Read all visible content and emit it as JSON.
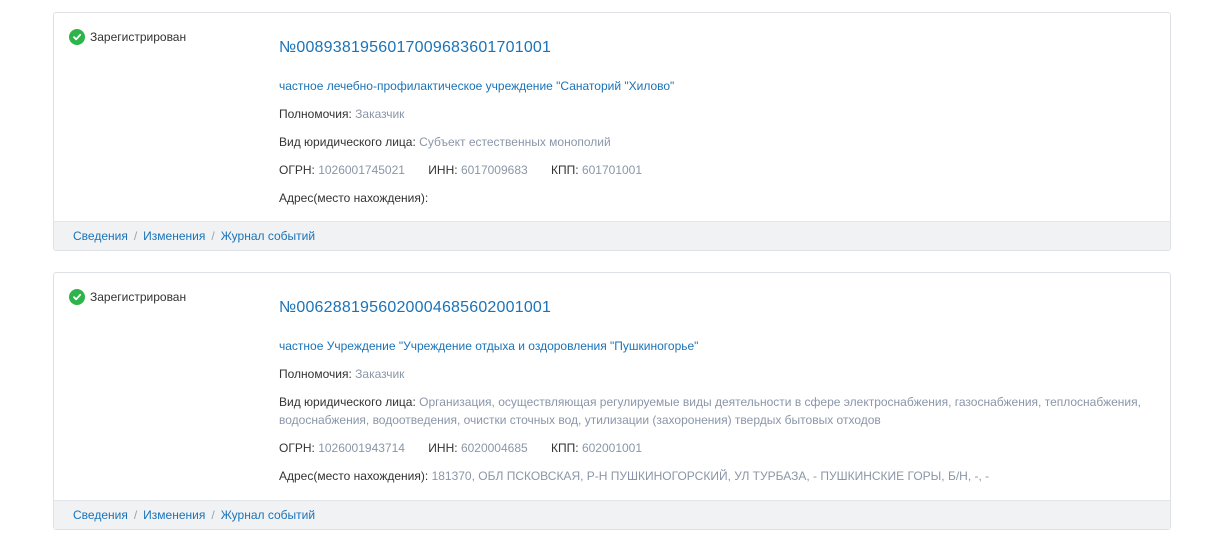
{
  "colors": {
    "link": "#1a73b8",
    "muted_value": "#8a96a8",
    "status_green": "#2db44a",
    "footer_bg": "#f0f2f4"
  },
  "entries": [
    {
      "status": "Зарегистрирован",
      "status_icon": "check-circle-icon",
      "number": "№00893819560170096836017010​01",
      "org_name": "частное лечебно-профилактическое учреждение \"Санаторий \"Хилово\"",
      "authority_label": "Полномочия:",
      "authority_value": "Заказчик",
      "entity_type_label": "Вид юридического лица:",
      "entity_type_value": "Субъект естественных монополий",
      "ogrn_label": "ОГРН:",
      "ogrn_value": "1026001745021",
      "inn_label": "ИНН:",
      "inn_value": "6017009683",
      "kpp_label": "КПП:",
      "kpp_value": "601701001",
      "address_label": "Адрес(место нахождения):",
      "address_value": "",
      "links": [
        "Сведения",
        "Изменения",
        "Журнал событий"
      ]
    },
    {
      "status": "Зарегистрирован",
      "status_icon": "check-circle-icon",
      "number": "№00628819560200046856020010​01",
      "org_name": "частное Учреждение \"Учреждение отдыха и оздоровления \"Пушкиногорье\"",
      "authority_label": "Полномочия:",
      "authority_value": "Заказчик",
      "entity_type_label": "Вид юридического лица:",
      "entity_type_value": "Организация, осуществляющая регулируемые виды деятельности в сфере электроснабжения, газоснабжения, теплоснабжения, водоснабжения, водоотведения, очистки сточных вод, утилизации (захоронения) твердых бытовых отходов",
      "ogrn_label": "ОГРН:",
      "ogrn_value": "1026001943714",
      "inn_label": "ИНН:",
      "inn_value": "6020004685",
      "kpp_label": "КПП:",
      "kpp_value": "602001001",
      "address_label": "Адрес(место нахождения):",
      "address_value": "181370, ОБЛ ПСКОВСКАЯ, Р-Н ПУШКИНОГОРСКИЙ, УЛ ТУРБАЗА, - ПУШКИНСКИЕ ГОРЫ, Б/Н, -, -",
      "links": [
        "Сведения",
        "Изменения",
        "Журнал событий"
      ]
    }
  ]
}
